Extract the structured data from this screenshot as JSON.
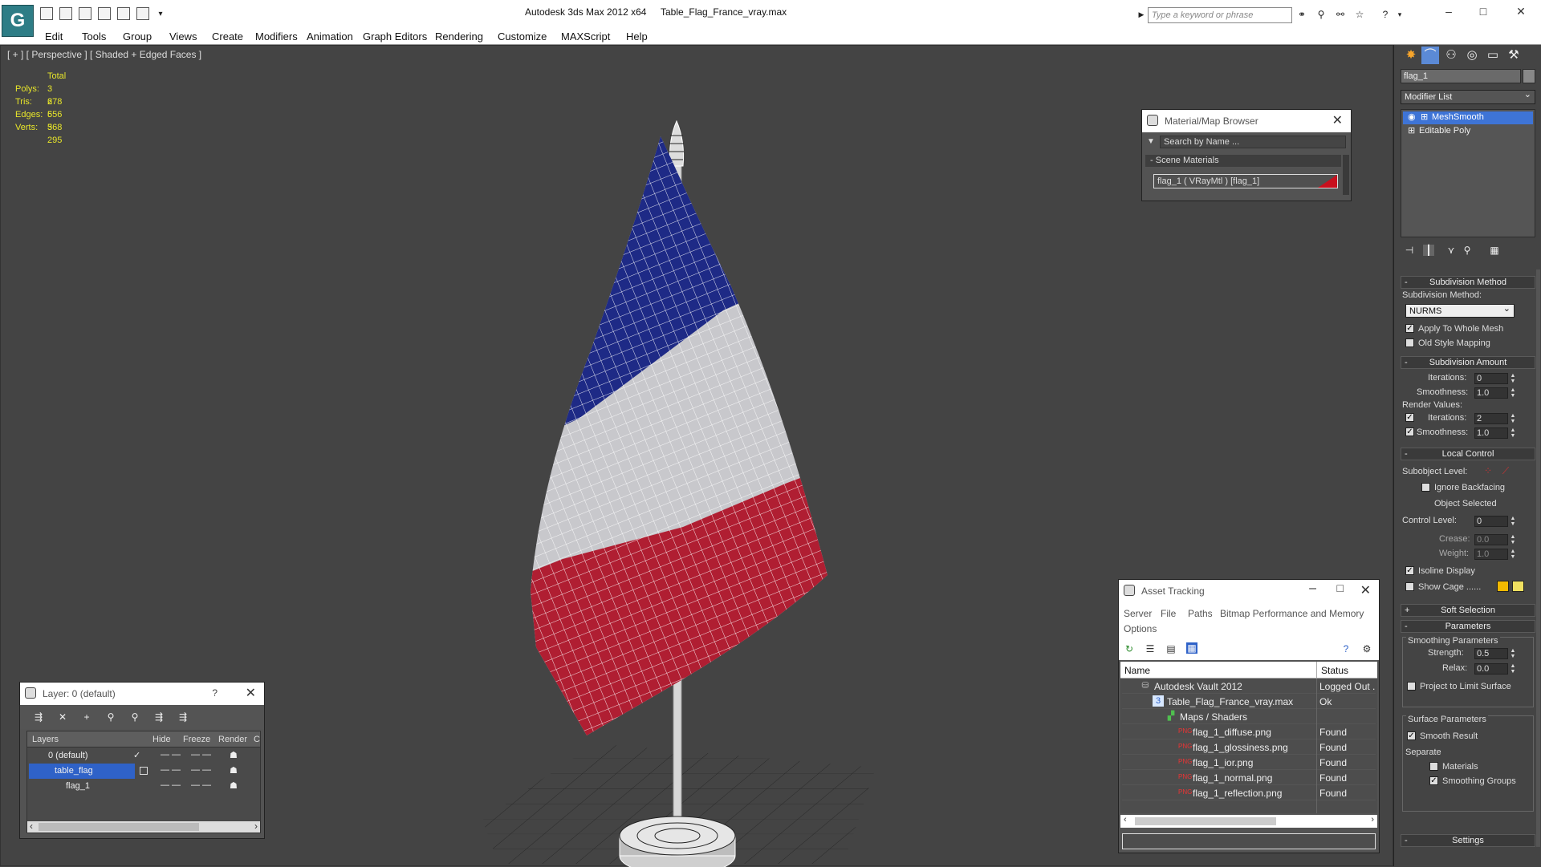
{
  "app": {
    "logo_letter": "G",
    "title": "Autodesk 3ds Max  2012 x64",
    "file": "Table_Flag_France_vray.max",
    "search_placeholder": "Type a keyword or phrase",
    "controls": {
      "minimize": "–",
      "maximize": "□",
      "close": "✕"
    }
  },
  "menu": [
    "Edit",
    "Tools",
    "Group",
    "Views",
    "Create",
    "Modifiers",
    "Animation",
    "Graph Editors",
    "Rendering",
    "Customize",
    "MAXScript",
    "Help"
  ],
  "viewport": {
    "label": "[ + ] [ Perspective ] [ Shaded + Edged Faces ]",
    "stats": {
      "header": "Total",
      "rows": [
        {
          "k": "Polys:",
          "v": "3 278"
        },
        {
          "k": "Tris:",
          "v": "6 556"
        },
        {
          "k": "Edges:",
          "v": "6 568"
        },
        {
          "k": "Verts:",
          "v": "3 295"
        }
      ]
    },
    "flag_colors": {
      "blue": "#1e2a86",
      "white": "#c8c8cc",
      "red": "#b01e32"
    }
  },
  "material_browser": {
    "title": "Material/Map Browser",
    "search_placeholder": "Search by Name ...",
    "group": "Scene Materials",
    "item": "flag_1  ( VRayMtl )  [flag_1]",
    "item_color": "#c8101e"
  },
  "asset_tracking": {
    "title": "Asset Tracking",
    "menu": [
      "Server",
      "File",
      "Paths",
      "Bitmap Performance and Memory",
      "Options"
    ],
    "columns": [
      "Name",
      "Status"
    ],
    "rows": [
      {
        "name": "Autodesk Vault 2012",
        "status": "Logged Out .",
        "indent": 1
      },
      {
        "name": "Table_Flag_France_vray.max",
        "status": "Ok",
        "indent": 2
      },
      {
        "name": "Maps / Shaders",
        "status": "",
        "indent": 3
      },
      {
        "name": "flag_1_diffuse.png",
        "status": "Found",
        "indent": 4
      },
      {
        "name": "flag_1_glossiness.png",
        "status": "Found",
        "indent": 4
      },
      {
        "name": "flag_1_ior.png",
        "status": "Found",
        "indent": 4
      },
      {
        "name": "flag_1_normal.png",
        "status": "Found",
        "indent": 4
      },
      {
        "name": "flag_1_reflection.png",
        "status": "Found",
        "indent": 4
      }
    ]
  },
  "layer_manager": {
    "title": "Layer: 0 (default)",
    "help": "?",
    "columns": [
      "Layers",
      "Hide",
      "Freeze",
      "Render",
      "C"
    ],
    "rows": [
      {
        "name": "0 (default)",
        "check": "✓"
      },
      {
        "name": "table_flag",
        "check": ""
      },
      {
        "name": "flag_1",
        "check": ""
      }
    ]
  },
  "command_panel": {
    "object_name": "flag_1",
    "modifier_list": "Modifier List",
    "stack": [
      "MeshSmooth",
      "Editable Poly"
    ],
    "rollouts": {
      "subdivision_method": "Subdivision Method",
      "subdivision_amount": "Subdivision Amount",
      "local_control": "Local Control",
      "soft_selection": "Soft Selection",
      "parameters": "Parameters",
      "settings": "Settings"
    },
    "subdivision_method_label": "Subdivision Method:",
    "subdivision_method_value": "NURMS",
    "apply_to_whole_mesh": "Apply To Whole Mesh",
    "old_style_mapping": "Old Style Mapping",
    "iterations_label": "Iterations:",
    "iterations_value": "0",
    "smoothness_label": "Smoothness:",
    "smoothness_value": "1.0",
    "render_values": "Render Values:",
    "render_iterations_value": "2",
    "render_smoothness_value": "1.0",
    "subobject_level": "Subobject Level:",
    "ignore_backfacing": "Ignore Backfacing",
    "object_selected": "Object Selected",
    "control_level_label": "Control Level:",
    "control_level_value": "0",
    "crease_label": "Crease:",
    "crease_value": "0.0",
    "weight_label": "Weight:",
    "weight_value": "1.0",
    "isoline_display": "Isoline Display",
    "show_cage": "Show Cage ......",
    "cage_colors": [
      "#f2b900",
      "#f0e060"
    ],
    "smoothing_parameters": "Smoothing Parameters",
    "strength_label": "Strength:",
    "strength_value": "0.5",
    "relax_label": "Relax:",
    "relax_value": "0.0",
    "project_to_limit": "Project to Limit Surface",
    "surface_parameters": "Surface Parameters",
    "smooth_result": "Smooth Result",
    "separate": "Separate",
    "materials": "Materials",
    "smoothing_groups": "Smoothing Groups"
  }
}
